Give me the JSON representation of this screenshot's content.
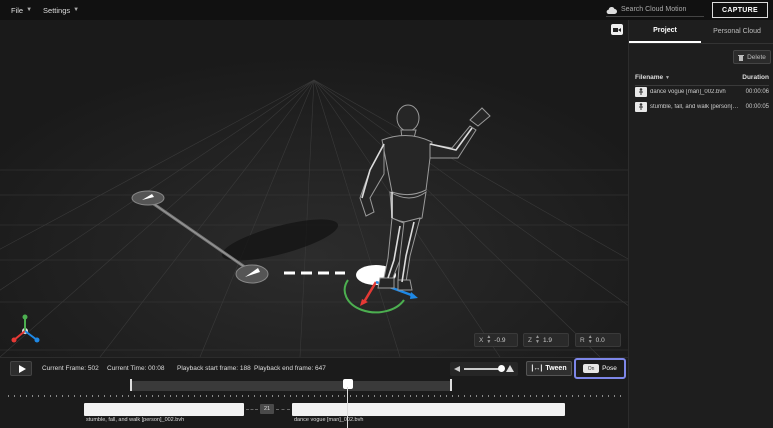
{
  "menu": {
    "file": "File",
    "settings": "Settings"
  },
  "search": {
    "placeholder": "Search Cloud Motion"
  },
  "capture_label": "CAPTURE",
  "panel": {
    "tabs": [
      {
        "label": "Project",
        "active": true
      },
      {
        "label": "Personal Cloud",
        "active": false
      }
    ],
    "delete_label": "Delete",
    "columns": {
      "filename": "Filename",
      "duration": "Duration"
    },
    "files": [
      {
        "name": "dance vogue [man]_002.bvh",
        "duration": "00:00:06"
      },
      {
        "name": "stumble, fall, and walk [person]_002.bvh",
        "duration": "00:00:05"
      }
    ]
  },
  "coords": {
    "x": {
      "label": "X",
      "value": "-0.9"
    },
    "z": {
      "label": "Z",
      "value": "1.9"
    },
    "r": {
      "label": "R",
      "value": "0.0"
    }
  },
  "controls": {
    "current_frame": "Current Frame: 502",
    "current_time": "Current Time: 00:08",
    "playback_start": "Playback start frame: 188",
    "playback_end": "Playback end frame: 647",
    "tween_label": "Tween",
    "pose_toggle": "On",
    "pose_label": "Pose"
  },
  "timeline": {
    "blend_frames": "21",
    "clips": [
      {
        "label": "stumble, fall, and walk [person]_002.bvh"
      },
      {
        "label": "dance vogue [man]_002.bvh"
      }
    ]
  },
  "colors": {
    "accent": "#7d86e8",
    "gizmo_green": "#4caf50",
    "gizmo_red": "#e53935",
    "gizmo_blue": "#1e88e5"
  }
}
